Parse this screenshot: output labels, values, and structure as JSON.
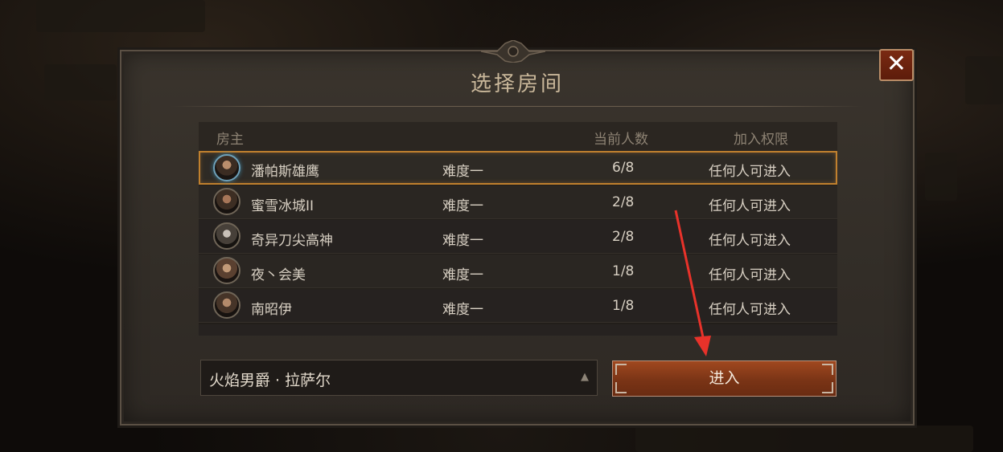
{
  "dialog": {
    "title": "选择房间",
    "close_label": "✕"
  },
  "table": {
    "headers": {
      "host": "房主",
      "count": "当前人数",
      "access": "加入权限"
    },
    "rows": [
      {
        "host": "潘帕斯雄鹰",
        "difficulty": "难度一",
        "count": "6/8",
        "access": "任何人可进入",
        "selected": true
      },
      {
        "host": "蜜雪冰城II",
        "difficulty": "难度一",
        "count": "2/8",
        "access": "任何人可进入"
      },
      {
        "host": "奇异刀尖高神",
        "difficulty": "难度一",
        "count": "2/8",
        "access": "任何人可进入"
      },
      {
        "host": "夜丶会美",
        "difficulty": "难度一",
        "count": "1/8",
        "access": "任何人可进入"
      },
      {
        "host": "南昭伊",
        "difficulty": "难度一",
        "count": "1/8",
        "access": "任何人可进入"
      }
    ]
  },
  "selector": {
    "value": "火焰男爵 · 拉萨尔",
    "caret": "▲"
  },
  "enter_button": {
    "label": "进入"
  },
  "colors": {
    "accent": "#c0802e",
    "button": "#8a3a18",
    "annotation_arrow": "#e8322a"
  }
}
